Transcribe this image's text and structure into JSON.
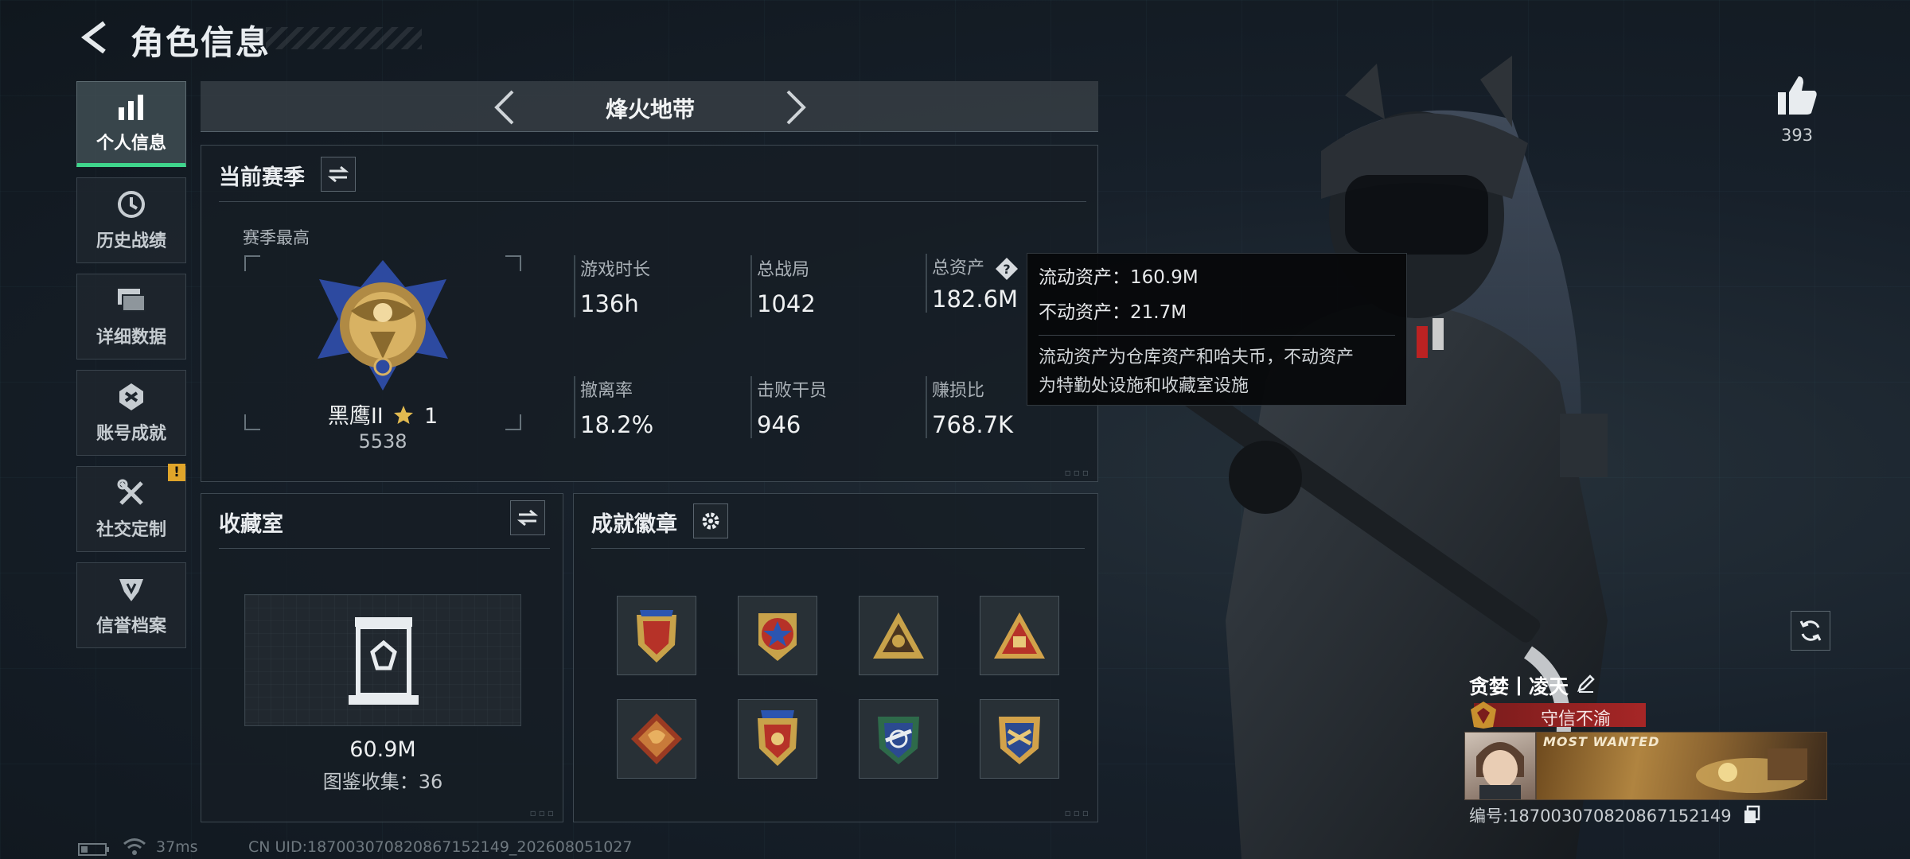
{
  "header": {
    "title": "角色信息"
  },
  "sidebar": {
    "items": [
      {
        "label": "个人信息",
        "icon": "bar-chart-icon",
        "active": true
      },
      {
        "label": "历史战绩",
        "icon": "history-clock-icon"
      },
      {
        "label": "详细数据",
        "icon": "cards-icon"
      },
      {
        "label": "账号成就",
        "icon": "achievement-icon"
      },
      {
        "label": "社交定制",
        "icon": "tools-icon",
        "badge": "!"
      },
      {
        "label": "信誉档案",
        "icon": "reputation-icon"
      }
    ]
  },
  "mode": {
    "title": "烽火地带"
  },
  "season": {
    "title": "当前赛季",
    "best_label": "赛季最高",
    "rank_name": "黑鹰II",
    "rank_stars": "1",
    "rank_score": "5538",
    "stats": [
      {
        "label": "游戏时长",
        "value": "136h"
      },
      {
        "label": "总战局",
        "value": "1042"
      },
      {
        "label": "总资产",
        "value": "182.6M"
      },
      {
        "label": "撤离率",
        "value": "18.2%"
      },
      {
        "label": "击败干员",
        "value": "946"
      },
      {
        "label": "赚损比",
        "value": "768.7K"
      }
    ]
  },
  "tooltip": {
    "liquid": "流动资产：160.9M",
    "fixed": "不动资产：21.7M",
    "desc_line1": "流动资产为仓库资产和哈夫币，不动资产",
    "desc_line2": "为特勤处设施和收藏室设施"
  },
  "collection": {
    "title": "收藏室",
    "value": "60.9M",
    "count": "图鉴收集：36"
  },
  "achievements": {
    "title": "成就徽章",
    "badges": [
      "shield-red-badge",
      "star-emblem-badge",
      "triangle-badge",
      "triangle-gold-badge",
      "dragon-badge",
      "shield-star-badge",
      "wing-emblem-badge",
      "gold-emblem-badge"
    ]
  },
  "player": {
    "likes": "393",
    "name": "贪婪丨凌天",
    "title_badge": "守信不渝",
    "banner_text": "MOST WANTED",
    "id_text": "编号:18700307082086715214​9"
  },
  "status": {
    "ping": "37ms",
    "uid": "CN UID:187003070820867152149_202608051027"
  },
  "colors": {
    "accent_green": "#3fd58c",
    "warning": "#e0a52a",
    "title_red": "#a62626"
  }
}
